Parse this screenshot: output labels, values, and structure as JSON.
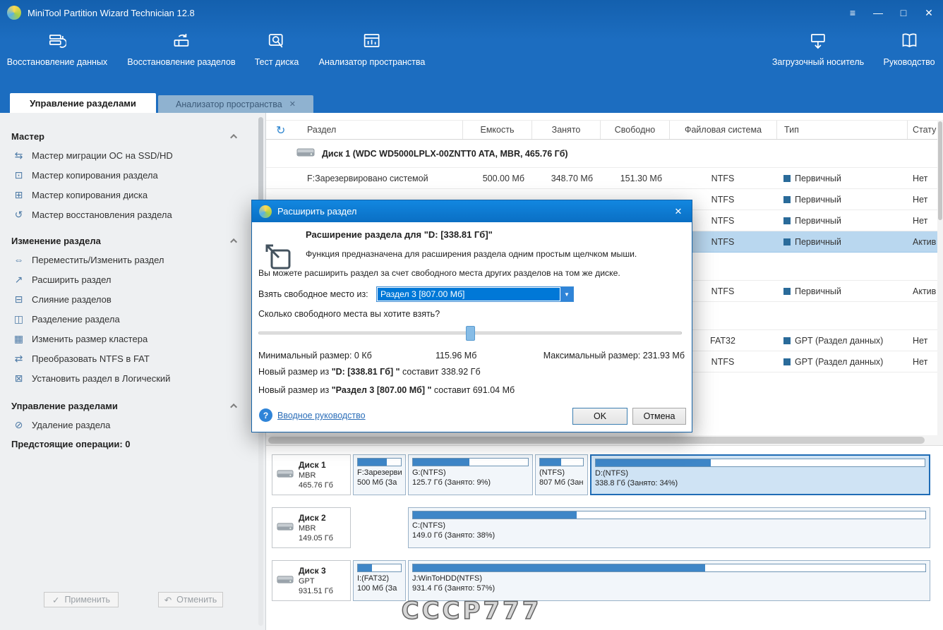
{
  "colors": {
    "header_blue": "#1c6dc0",
    "dialog_title_blue": "#0d7dd6",
    "accent": "#0078d7",
    "bar_fill": "#3e86c7",
    "row_selection": "#b9d7ef",
    "type_square": "#2a6b9a"
  },
  "window": {
    "title": "MiniTool Partition Wizard Technician 12.8"
  },
  "window_controls": {
    "menu": "≡",
    "minimize": "—",
    "maximize": "□",
    "close": "✕"
  },
  "toolbar": {
    "items": [
      {
        "label": "Восстановление данных"
      },
      {
        "label": "Восстановление разделов"
      },
      {
        "label": "Тест диска"
      },
      {
        "label": "Анализатор пространства"
      },
      {
        "label": "Загрузочный носитель"
      },
      {
        "label": "Руководство"
      }
    ]
  },
  "tabs": {
    "active": "Управление разделами",
    "inactive": "Анализатор пространства",
    "close_glyph": "✕"
  },
  "sidebar": {
    "sections": [
      {
        "title": "Мастер",
        "items": [
          {
            "glyph": "⇆",
            "label": "Мастер миграции ОС на SSD/HD"
          },
          {
            "glyph": "⊡",
            "label": "Мастер копирования раздела"
          },
          {
            "glyph": "⊞",
            "label": "Мастер копирования диска"
          },
          {
            "glyph": "↺",
            "label": "Мастер восстановления раздела"
          }
        ]
      },
      {
        "title": "Изменение раздела",
        "items": [
          {
            "glyph": "⇔",
            "label": "Переместить/Изменить раздел"
          },
          {
            "glyph": "↗",
            "label": "Расширить раздел"
          },
          {
            "glyph": "⊟",
            "label": "Слияние разделов"
          },
          {
            "glyph": "◫",
            "label": "Разделение раздела"
          },
          {
            "glyph": "▦",
            "label": "Изменить размер кластера"
          },
          {
            "glyph": "⇄",
            "label": "Преобразовать NTFS в FAT"
          },
          {
            "glyph": "⊠",
            "label": "Установить раздел в Логический"
          }
        ]
      },
      {
        "title": "Управление разделами",
        "items": [
          {
            "glyph": "⊘",
            "label": "Удаление раздела"
          }
        ]
      }
    ],
    "pending": "Предстоящие операции: 0",
    "apply": "Применить",
    "apply_glyph": "✓",
    "undo": "Отменить",
    "undo_glyph": "↶"
  },
  "table": {
    "refresh_glyph": "↻",
    "columns": [
      "Раздел",
      "Емкость",
      "Занято",
      "Свободно",
      "Файловая система",
      "Тип",
      "Стату"
    ],
    "rows": [
      {
        "kind": "disk",
        "label": "Диск 1 (WDC WD5000LPLX-00ZNTT0 ATA, MBR, 465.76 Гб)"
      },
      {
        "kind": "partition",
        "name": "F:Зарезервировано системой",
        "capacity": "500.00 Мб",
        "used": "348.70 Мб",
        "free": "151.30 Мб",
        "fs": "NTFS",
        "type": "Первичный",
        "status": "Нет"
      },
      {
        "kind": "partition",
        "fs": "NTFS",
        "type": "Первичный",
        "status": "Нет"
      },
      {
        "kind": "partition",
        "fs": "NTFS",
        "type": "Первичный",
        "status": "Нет"
      },
      {
        "kind": "partition",
        "fs": "NTFS",
        "type": "Первичный",
        "status": "Актив",
        "selected": true
      },
      {
        "kind": "disk"
      },
      {
        "kind": "partition",
        "fs": "NTFS",
        "type": "Первичный",
        "status": "Актив"
      },
      {
        "kind": "disk"
      },
      {
        "kind": "partition",
        "fs": "FAT32",
        "type": "GPT (Раздел данных)",
        "status": "Нет"
      },
      {
        "kind": "partition",
        "fs": "NTFS",
        "type": "GPT (Раздел данных)",
        "status": "Нет"
      }
    ]
  },
  "dialog": {
    "title": "Расширить раздел",
    "close_glyph": "✕",
    "heading": "Расширение раздела для \"D: [338.81 Гб]\"",
    "description_1": "Функция предназначена для расширения раздела одним простым щелчком мыши.",
    "description_2": "Вы можете расширить раздел за счет свободного места других разделов на том же диске.",
    "take_from_label": "Взять свободное место из:",
    "combo_value": "Раздел 3 [807.00 Мб]",
    "combo_arrow": "▼",
    "slider_question": "Сколько свободного места вы хотите взять?",
    "slider_percent": 50,
    "min_label": "Минимальный размер: 0 Кб",
    "current_value": "115.96 Мб",
    "max_label": "Максимальный размер: 231.93 Мб",
    "new_size_1": {
      "prefix": "Новый размер из ",
      "bold": "\"D: [338.81 Гб] \"",
      "suffix": " составит 338.92 Гб"
    },
    "new_size_2": {
      "prefix": "Новый размер из ",
      "bold": "\"Раздел 3 [807.00 Мб] \"",
      "suffix": " составит 691.04 Мб"
    },
    "help_glyph": "?",
    "help_link": "Вводное руководство",
    "ok": "OK",
    "cancel": "Отмена"
  },
  "disk_map": {
    "disks": [
      {
        "name": "Диск 1",
        "scheme": "MBR",
        "size": "465.76 Гб",
        "partitions": [
          {
            "line1": "F:Зарезерви",
            "line2": "500 Мб (За",
            "bar_percent": 68
          },
          {
            "line1": "G:(NTFS)",
            "line2": "125.7 Гб (Занято: 9%)",
            "bar_percent": 49
          },
          {
            "line1": "(NTFS)",
            "line2": "807 Мб (Зан",
            "bar_percent": 49
          },
          {
            "line1": "D:(NTFS)",
            "line2": "338.8 Гб (Занято: 34%)",
            "bar_percent": 35,
            "selected": true
          }
        ]
      },
      {
        "name": "Диск 2",
        "scheme": "MBR",
        "size": "149.05 Гб",
        "partitions": [
          {
            "line1": "C:(NTFS)",
            "line2": "149.0 Гб (Занято: 38%)",
            "bar_percent": 32
          }
        ]
      },
      {
        "name": "Диск 3",
        "scheme": "GPT",
        "size": "931.51 Гб",
        "partitions": [
          {
            "line1": "I:(FAT32)",
            "line2": "100 Мб (За",
            "bar_percent": 33
          },
          {
            "line1": "J:WinToHDD(NTFS)",
            "line2": "931.4 Гб (Занято: 57%)",
            "bar_percent": 57
          }
        ]
      }
    ]
  },
  "watermark": "СССР777"
}
